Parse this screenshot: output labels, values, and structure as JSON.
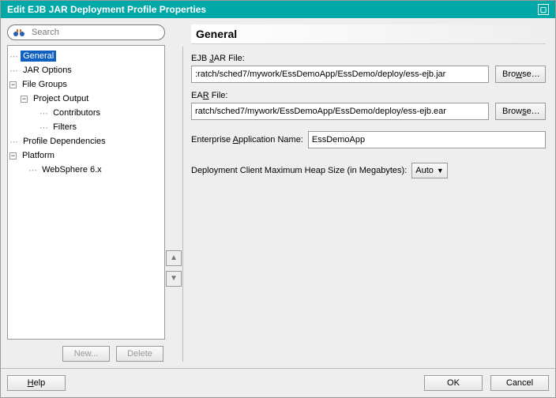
{
  "title": "Edit EJB JAR Deployment Profile Properties",
  "search": {
    "placeholder": "Search"
  },
  "tree": {
    "items": {
      "general": "General",
      "jarOptions": "JAR Options",
      "fileGroups": "File Groups",
      "projectOutput": "Project Output",
      "contributors": "Contributors",
      "filters": "Filters",
      "profileDeps": "Profile Dependencies",
      "platform": "Platform",
      "websphere": "WebSphere 6.x"
    },
    "buttons": {
      "new": "New...",
      "delete": "Delete"
    }
  },
  "main": {
    "heading": "General",
    "ejbJarLabelPre": "EJB ",
    "ejbJarLabelU": "J",
    "ejbJarLabelPost": "AR File:",
    "ejbJarValue": ":ratch/sched7/mywork/EssDemoApp/EssDemo/deploy/ess-ejb.jar",
    "earLabelPre": "EA",
    "earLabelU": "R",
    "earLabelPost": " File:",
    "earValue": "ratch/sched7/mywork/EssDemoApp/EssDemo/deploy/ess-ejb.ear",
    "browse1Pre": "Bro",
    "browse1U": "w",
    "browse1Post": "se…",
    "browse2Pre": "Brow",
    "browse2U": "s",
    "browse2Post": "e…",
    "appNamePre": "Enterprise ",
    "appNameU": "A",
    "appNamePost": "pplication Name:",
    "appNameValue": "EssDemoApp",
    "heapLabel": "Deployment Client Maximum Heap Size (in Megabytes):",
    "heapValue": "Auto"
  },
  "footer": {
    "helpU": "H",
    "helpPost": "elp",
    "ok": "OK",
    "cancel": "Cancel"
  }
}
